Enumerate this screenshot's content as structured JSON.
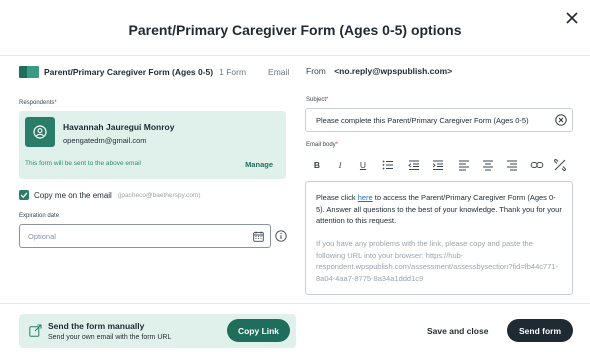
{
  "modal": {
    "title": "Parent/Primary Caregiver Form (Ages 0-5) options",
    "close_icon": "close-icon"
  },
  "form_header": {
    "form_name": "Parent/Primary Caregiver Form (Ages 0-5)",
    "form_count": "1 Form",
    "channel": "Email",
    "from_label": "From",
    "from_value": "<no.reply@wpspublish.com>"
  },
  "respondents": {
    "label": "Respondents",
    "required_mark": "*",
    "name": "Havannah Jauregui Monroy",
    "email": "opengatedm@gmail.com",
    "note": "This form will be sent to the above email",
    "manage_label": "Manage",
    "avatar_icon": "user-icon"
  },
  "copy_me": {
    "checked": true,
    "label": "Copy me on the email",
    "email": "(jpacheco@baetherspy.com)"
  },
  "expiration": {
    "label": "Expiration date",
    "placeholder": "Optional",
    "calendar_icon": "calendar-icon",
    "info_icon": "info-icon"
  },
  "subject": {
    "label": "Subject",
    "required_mark": "*",
    "value": "Please complete this Parent/Primary Caregiver Form (Ages 0-5)",
    "clear_icon": "clear-icon"
  },
  "email_body": {
    "label": "Email body",
    "required_mark": "*",
    "toolbar": [
      "bold-icon",
      "italic-icon",
      "underline-icon",
      "bullet-list-icon",
      "outdent-icon",
      "indent-icon",
      "align-left-icon",
      "align-center-icon",
      "align-right-icon",
      "link-icon",
      "unlink-icon"
    ],
    "text_before_link": "Please click ",
    "link_text": "here",
    "text_after_link": " to access the Parent/Primary Caregiver Form (Ages 0-5). Answer all questions to the best of your knowledge. Thank you for your attention to this request.",
    "help_text": "If you have any problems with the link, please copy and paste the following URL into your browser: https://hub-respondent.wpspublish.com/assessment/assessbysection?fid=fb44c771-8a04-4aa7-8775-8a34a1ddd1c9"
  },
  "manual": {
    "title": "Send the form manually",
    "subtitle": "Send your own email with the form URL",
    "copy_link_label": "Copy Link",
    "icon": "send-link-icon"
  },
  "actions": {
    "save_close_label": "Save and close",
    "send_label": "Send form"
  },
  "colors": {
    "accent": "#1f6e5c",
    "card_bg": "#e0f1ec",
    "dark": "#1f2a33",
    "link": "#1a73c9"
  }
}
